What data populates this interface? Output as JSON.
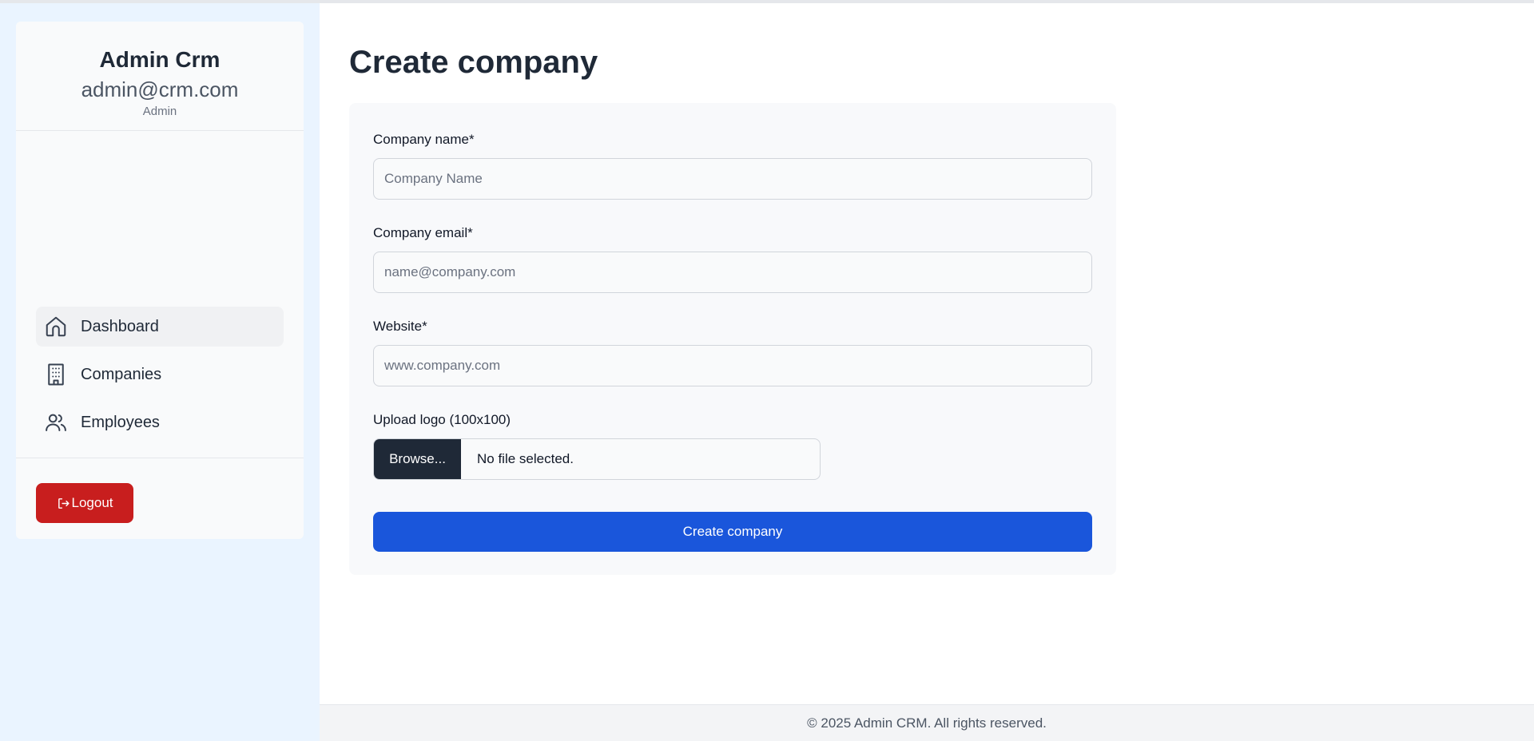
{
  "sidebar": {
    "user_name": "Admin Crm",
    "user_email": "admin@crm.com",
    "user_role": "Admin",
    "nav": [
      {
        "label": "Dashboard",
        "icon": "home-icon",
        "active": true
      },
      {
        "label": "Companies",
        "icon": "building-icon",
        "active": false
      },
      {
        "label": "Employees",
        "icon": "users-icon",
        "active": false
      }
    ],
    "logout_label": "Logout"
  },
  "main": {
    "title": "Create company",
    "form": {
      "name_label": "Company name*",
      "name_placeholder": "Company Name",
      "email_label": "Company email*",
      "email_placeholder": "name@company.com",
      "website_label": "Website*",
      "website_placeholder": "www.company.com",
      "logo_label": "Upload logo (100x100)",
      "browse_label": "Browse...",
      "file_status": "No file selected.",
      "submit_label": "Create company"
    }
  },
  "footer": {
    "text": "© 2025 Admin CRM. All rights reserved."
  },
  "colors": {
    "primary": "#1a56db",
    "danger": "#c81e1e",
    "dark": "#1f2937",
    "sidebar_bg": "#eaf4ff"
  }
}
